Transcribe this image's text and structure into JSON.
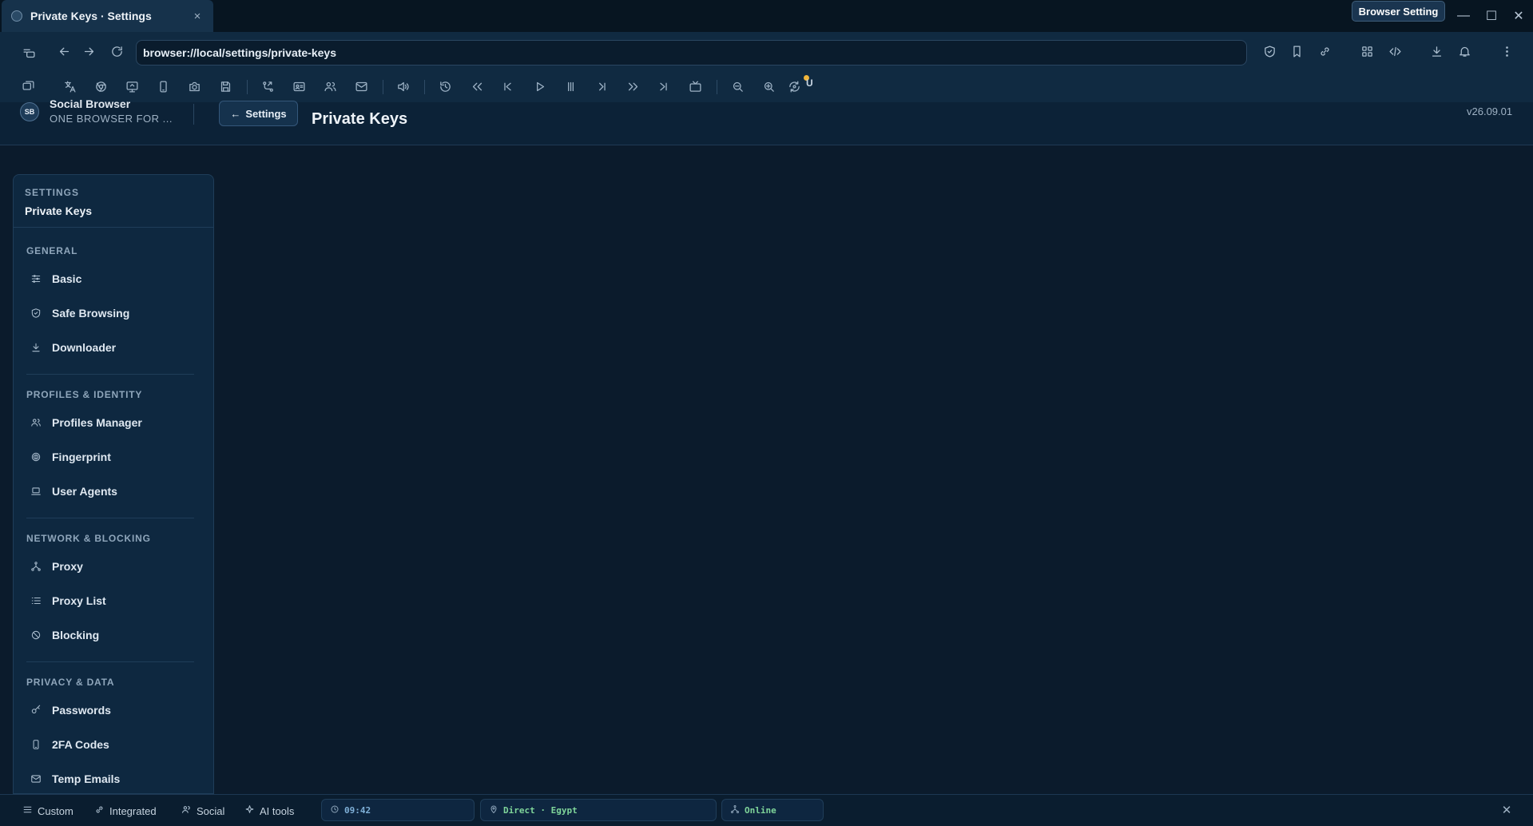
{
  "tab": {
    "title": "Private Keys · Settings",
    "close": "×"
  },
  "window": {
    "browser_setting": "Browser Setting",
    "minimize": "—",
    "maximize": "☐",
    "close": "✕"
  },
  "address": {
    "url": "browser://local/settings/private-keys"
  },
  "toolbar": {
    "badge": "U"
  },
  "header": {
    "brand_name": "Social Browser",
    "brand_tag": "ONE BROWSER FOR ...",
    "logo_text": "SB",
    "back_arrow": "←",
    "back_label": "Settings",
    "page_title": "Private Keys",
    "version": "v26.09.01"
  },
  "sidebar": {
    "kicker": "SETTINGS",
    "current": "Private Keys",
    "sections": [
      {
        "title": "GENERAL",
        "items": [
          "Basic",
          "Safe Browsing",
          "Downloader"
        ]
      },
      {
        "title": "PROFILES & IDENTITY",
        "items": [
          "Profiles Manager",
          "Fingerprint",
          "User Agents"
        ]
      },
      {
        "title": "NETWORK & BLOCKING",
        "items": [
          "Proxy",
          "Proxy List",
          "Blocking"
        ]
      },
      {
        "title": "PRIVACY & DATA",
        "items": [
          "Passwords",
          "2FA Codes",
          "Temp Emails"
        ]
      }
    ]
  },
  "statusbar": {
    "buttons": [
      "Custom",
      "Integrated",
      "Social",
      "AI tools"
    ],
    "time": "09:42",
    "proxy": "Direct · Egypt",
    "connection": "Online",
    "close": "✕",
    "colors": {
      "time": "#7fb0d8",
      "proxy": "#7fd59a",
      "online": "#7fd59a"
    }
  }
}
